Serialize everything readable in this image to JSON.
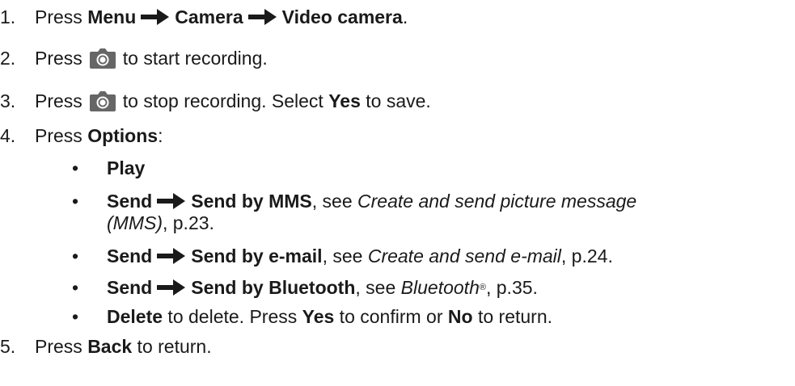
{
  "steps": [
    {
      "num": "1.",
      "prefix": "Press ",
      "menu": "Menu",
      "camera": "Camera",
      "video_camera": "Video camera",
      "suffix": "."
    },
    {
      "num": "2.",
      "prefix": "Press",
      "suffix": "to start recording."
    },
    {
      "num": "3.",
      "prefix": "Press",
      "suffix": "to stop recording. Select ",
      "yes": "Yes",
      "tail": " to save."
    },
    {
      "num": "4.",
      "prefix": "Press ",
      "options": "Options",
      "suffix": ":"
    },
    {
      "num": "5.",
      "prefix": "Press ",
      "back": "Back",
      "suffix": " to return."
    }
  ],
  "options_list": [
    {
      "play": "Play"
    },
    {
      "send": "Send",
      "target": "Send by MMS",
      "see": ", see ",
      "ref": "Create and send picture message",
      "ref2": "(MMS)",
      "page": ", p.23."
    },
    {
      "send": "Send",
      "target": "Send by e-mail",
      "see": ", see ",
      "ref": "Create and send e-mail",
      "page": ", p.24."
    },
    {
      "send": "Send",
      "target": "Send by Bluetooth",
      "see": ", see ",
      "ref": "Bluetooth",
      "reg": "®",
      "page": ", p.35."
    },
    {
      "delete": "Delete",
      "mid": " to delete. Press ",
      "yes": "Yes",
      "mid2": " to confirm or ",
      "no": "No",
      "tail": " to return."
    }
  ],
  "bullet_char": "•",
  "icons": {
    "arrow": "right-arrow-icon",
    "camera": "camera-shutter-icon"
  },
  "colors": {
    "text": "#1a1a1a",
    "icon_bg": "#666666",
    "icon_fg": "#ffffff"
  }
}
